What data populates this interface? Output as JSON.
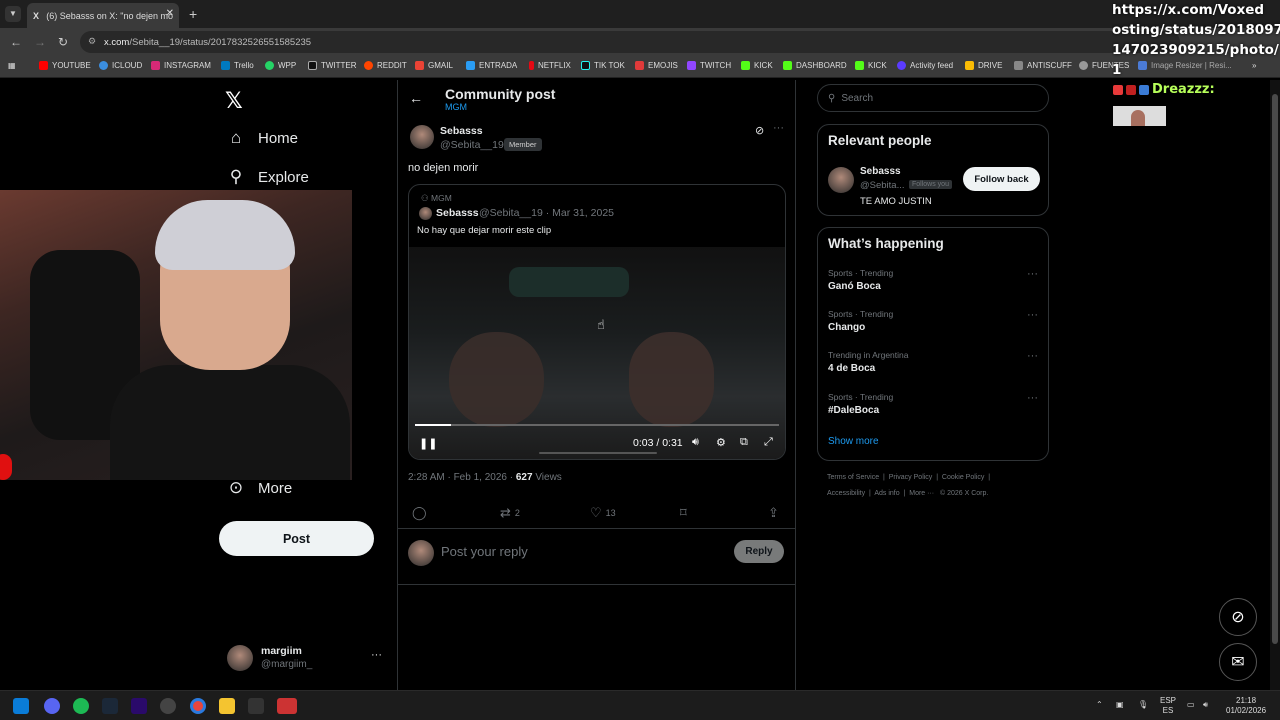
{
  "browser": {
    "tab_title": "(6) Sebasss on X: \"no dejen mo",
    "url_host": "x.com",
    "url_path": "/Sebita__19/status/2017832526551585235",
    "bookmarks": [
      "YOUTUBE",
      "ICLOUD",
      "INSTAGRAM",
      "Trello",
      "WPP",
      "TWITTER",
      "REDDIT",
      "GMAIL",
      "ENTRADA",
      "NETFLIX",
      "TIK TOK",
      "EMOJIS",
      "TWITCH",
      "KICK",
      "DASHBOARD",
      "KICK",
      "Activity feed",
      "DRIVE",
      "ANTISCUFF",
      "FUENTES",
      "Image Resizer | Resi..."
    ]
  },
  "overlay": {
    "url_lines": [
      "https://x.com/Voxed",
      "osting/status/2018097",
      "147023909215/photo/",
      "1"
    ],
    "name": "Dreazzz:"
  },
  "nav": {
    "home": "Home",
    "explore": "Explore",
    "more": "More",
    "post_button": "Post",
    "user_name": "margiim",
    "user_handle": "@margiim_"
  },
  "header": {
    "title": "Community post",
    "community": "MGM"
  },
  "post": {
    "author_name": "Sebasss",
    "author_handle": "@Sebita__19 ·",
    "badge": "Member",
    "text": "no dejen morir",
    "quote": {
      "community": "MGM",
      "author_name": "Sebasss",
      "author_handle": "@Sebita__19 · Mar 31, 2025",
      "text": "No hay que dejar morir este clip",
      "video_time": "0:03 / 0:31",
      "progress": 0.1
    },
    "meta_time": "2:28 AM · Feb 1, 2026 ·",
    "views_count": "627",
    "views_label": "Views",
    "retweets": "2",
    "likes": "13",
    "reply_placeholder": "Post your reply",
    "reply_button": "Reply"
  },
  "sidebar": {
    "search_placeholder": "Search",
    "relevant_title": "Relevant people",
    "person": {
      "name": "Sebasss",
      "handle": "@Sebita...",
      "follows_you": "Follows you",
      "bio": "TE AMO JUSTIN",
      "follow_button": "Follow back"
    },
    "happening_title": "What’s happening",
    "trends": [
      {
        "category": "Sports · Trending",
        "name": "Ganó Boca"
      },
      {
        "category": "Sports · Trending",
        "name": "Chango"
      },
      {
        "category": "Trending in Argentina",
        "name": "4 de Boca"
      },
      {
        "category": "Sports · Trending",
        "name": "#DaleBoca"
      }
    ],
    "show_more": "Show more",
    "footer_line1": [
      "Terms of Service",
      "Privacy Policy",
      "Cookie Policy"
    ],
    "footer_line2": [
      "Accessibility",
      "Ads info",
      "More ···",
      "© 2026 X Corp."
    ]
  },
  "taskbar": {
    "lang_top": "ESP",
    "lang_bottom": "ES",
    "time": "21:18",
    "date": "01/02/2026"
  },
  "colors": {
    "accent": "#1d9bf0",
    "background": "#000000",
    "border": "#2f3336",
    "muted": "#71767b"
  }
}
